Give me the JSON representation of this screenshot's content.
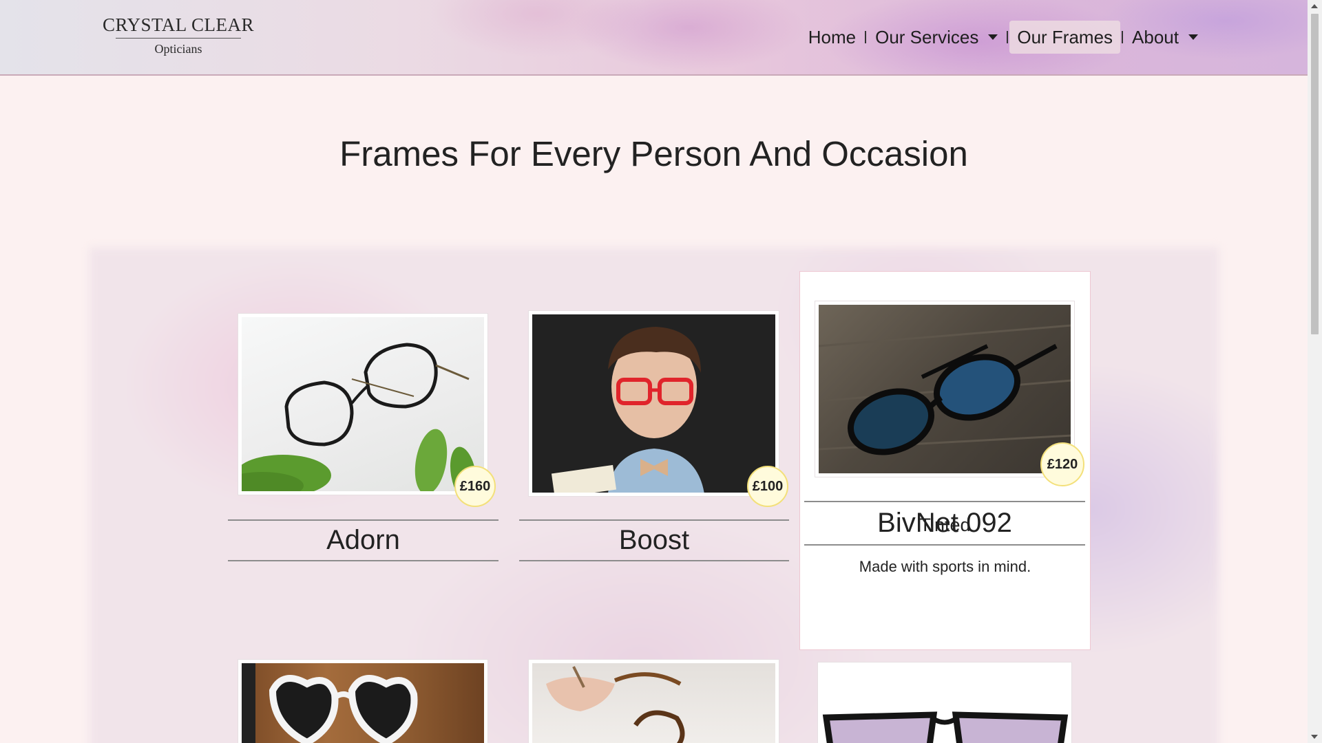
{
  "brand": {
    "name": "CRYSTAL CLEAR",
    "subtitle": "Opticians"
  },
  "nav": {
    "items": [
      {
        "label": "Home",
        "dropdown": false,
        "active": false
      },
      {
        "label": "Our Services",
        "dropdown": true,
        "active": false
      },
      {
        "label": "Our Frames",
        "dropdown": false,
        "active": true
      },
      {
        "label": "About",
        "dropdown": true,
        "active": false
      }
    ]
  },
  "page": {
    "title": "Frames For Every Person And Occasion"
  },
  "frames": [
    {
      "name": "Adorn",
      "price": "£160",
      "image": "black-rimmed-glasses-with-leaves-photo"
    },
    {
      "name": "Boost",
      "price": "£100",
      "image": "boy-wearing-red-glasses-photo"
    },
    {
      "name": "BivNet 092",
      "price": "£120",
      "image": "black-tinted-sunglasses-on-wood-photo",
      "type": "Tinted",
      "description": "Made with sports in mind."
    },
    {
      "image": "white-heart-sunglasses-photo"
    },
    {
      "image": "hand-holding-tortoiseshell-glasses-photo"
    },
    {
      "image": "purple-tinted-sunglasses-photo"
    }
  ],
  "colors": {
    "page_bg": "#fcf1f1",
    "price_badge_bg": "#fffbdc",
    "price_badge_border": "#f3e07a",
    "featured_border": "#eec7d2"
  }
}
